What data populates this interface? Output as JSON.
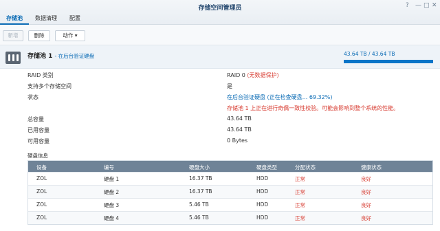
{
  "window": {
    "title": "存储空间管理员",
    "tabs": [
      {
        "label": "存储池",
        "active": true
      },
      {
        "label": "数据清理",
        "active": false
      },
      {
        "label": "配置",
        "active": false
      }
    ],
    "controls": [
      "?",
      "—",
      "□",
      "✕"
    ]
  },
  "toolbar": {
    "new_label": "新增",
    "delete_label": "删除",
    "action_label": "动作 ▾"
  },
  "pool": {
    "name": "存储池 1",
    "status_sub": "在后台验证硬盘",
    "usage_text": "43.64 TB / 43.64 TB",
    "usage_fraction": 1.0
  },
  "info": [
    {
      "label": "RAID 类别",
      "value": "RAID 0",
      "value_note": "(无数据保护)"
    },
    {
      "label": "支持多个存储空间",
      "value": "是"
    },
    {
      "label": "状态",
      "value": "在后台验证硬盘 (正在检查硬盘... 69.32%)",
      "warning": "存储池 1 上正在进行奇偶一致性校验。可能会影响到整个系统的性能。"
    },
    {
      "label": "总容量",
      "value": "43.64 TB"
    },
    {
      "label": "已用容量",
      "value": "43.64 TB"
    },
    {
      "label": "可用容量",
      "value": "0 Bytes"
    }
  ],
  "disks": {
    "section_title": "硬盘信息",
    "headers": [
      "设备",
      "编号",
      "硬盘大小",
      "硬盘类型",
      "分配状态",
      "健康状态"
    ],
    "rows": [
      [
        "ZOL",
        "硬盘 1",
        "16.37 TB",
        "HDD",
        "正常",
        "良好"
      ],
      [
        "ZOL",
        "硬盘 2",
        "16.37 TB",
        "HDD",
        "正常",
        "良好"
      ],
      [
        "ZOL",
        "硬盘 3",
        "5.46 TB",
        "HDD",
        "正常",
        "良好"
      ],
      [
        "ZOL",
        "硬盘 4",
        "5.46 TB",
        "HDD",
        "正常",
        "良好"
      ]
    ]
  },
  "colors": {
    "accent": "#0a6bb5",
    "warning": "#d73a2f",
    "table_header": "#6f8397"
  }
}
